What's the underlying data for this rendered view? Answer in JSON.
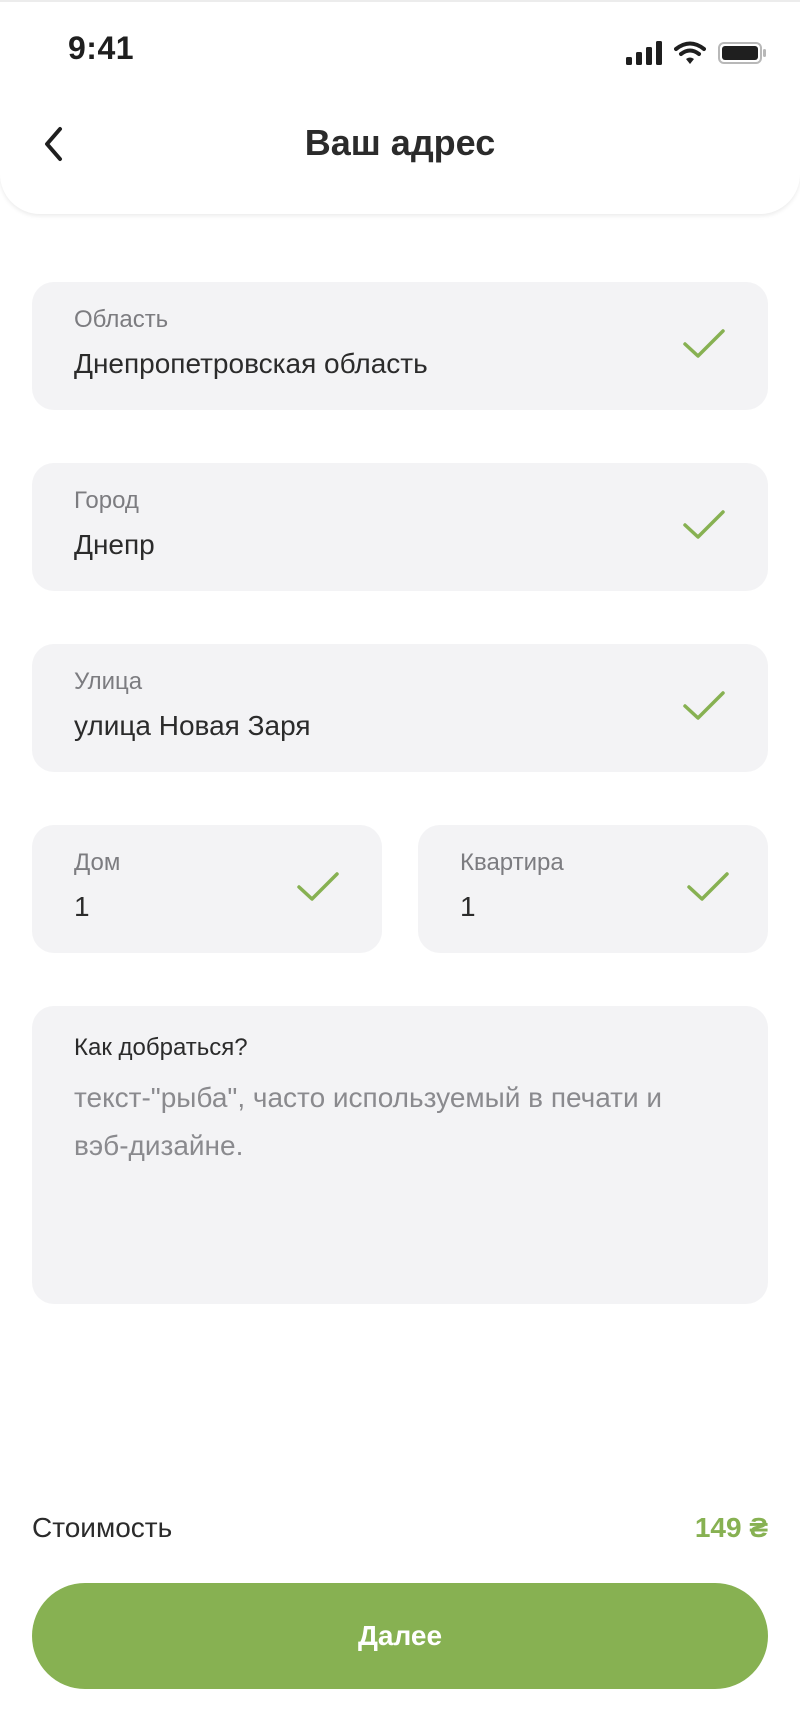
{
  "status_bar": {
    "time": "9:41",
    "icons": [
      "cellular-signal-icon",
      "wifi-icon",
      "battery-icon"
    ]
  },
  "header": {
    "title": "Ваш адрес",
    "back_icon": "chevron-left-icon"
  },
  "form": {
    "region": {
      "label": "Область",
      "value": "Днепропетровская область",
      "valid": true
    },
    "city": {
      "label": "Город",
      "value": "Днепр",
      "valid": true
    },
    "street": {
      "label": "Улица",
      "value": "улица Новая Заря",
      "valid": true
    },
    "house": {
      "label": "Дом",
      "value": "1",
      "valid": true
    },
    "apartment": {
      "label": "Квартира",
      "value": "1",
      "valid": true
    },
    "directions": {
      "label": "Как добраться?",
      "placeholder": "текст-\"рыба\", часто используемый в печати и вэб-дизайне."
    }
  },
  "summary": {
    "cost_label": "Стоимость",
    "cost_value": "149 ₴"
  },
  "actions": {
    "next_label": "Далее"
  },
  "colors": {
    "accent": "#87b152",
    "field_background": "#f3f3f5",
    "label": "#7c7c80",
    "text": "#2b2b2b"
  }
}
